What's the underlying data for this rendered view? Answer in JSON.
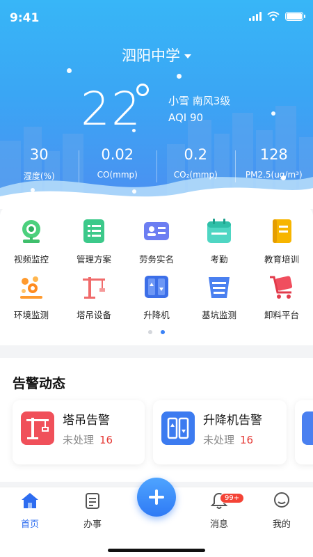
{
  "status_bar": {
    "time": "9:41"
  },
  "header": {
    "location": "泗阳中学",
    "temperature": "22",
    "condition": "小雪  南风3级",
    "aqi": "AQI 90"
  },
  "stats": [
    {
      "value": "30",
      "label": "湿度(%)"
    },
    {
      "value": "0.02",
      "label": "CO(mmp)"
    },
    {
      "value": "0.2",
      "label": "CO₂(mmp)"
    },
    {
      "value": "128",
      "label": "PM2.5(ug/m³)"
    }
  ],
  "menu": {
    "items": [
      {
        "label": "视频监控",
        "icon": "camera-icon"
      },
      {
        "label": "管理方案",
        "icon": "list-icon"
      },
      {
        "label": "劳务实名",
        "icon": "id-card-icon"
      },
      {
        "label": "考勤",
        "icon": "calendar-icon"
      },
      {
        "label": "教育培训",
        "icon": "book-icon"
      },
      {
        "label": "环境监测",
        "icon": "environment-icon"
      },
      {
        "label": "塔吊设备",
        "icon": "tower-crane-icon"
      },
      {
        "label": "升降机",
        "icon": "elevator-icon"
      },
      {
        "label": "基坑监测",
        "icon": "pit-icon"
      },
      {
        "label": "卸料平台",
        "icon": "cart-icon"
      }
    ],
    "page_count": 2,
    "current_page": 2
  },
  "alerts": {
    "title": "告警动态",
    "cards": [
      {
        "name": "塔吊告警",
        "status": "未处理",
        "count": "16",
        "color": "#f0505a"
      },
      {
        "name": "升降机告警",
        "status": "未处理",
        "count": "16",
        "color": "#3c7bf0"
      }
    ]
  },
  "tabbar": {
    "items": [
      {
        "label": "首页"
      },
      {
        "label": "办事"
      },
      {
        "label": "消息"
      },
      {
        "label": "我的"
      }
    ],
    "badge": "99+"
  },
  "colors": {
    "accent": "#2d6cf0",
    "sky": "#3aa6f4",
    "alert_red": "#e53935"
  }
}
